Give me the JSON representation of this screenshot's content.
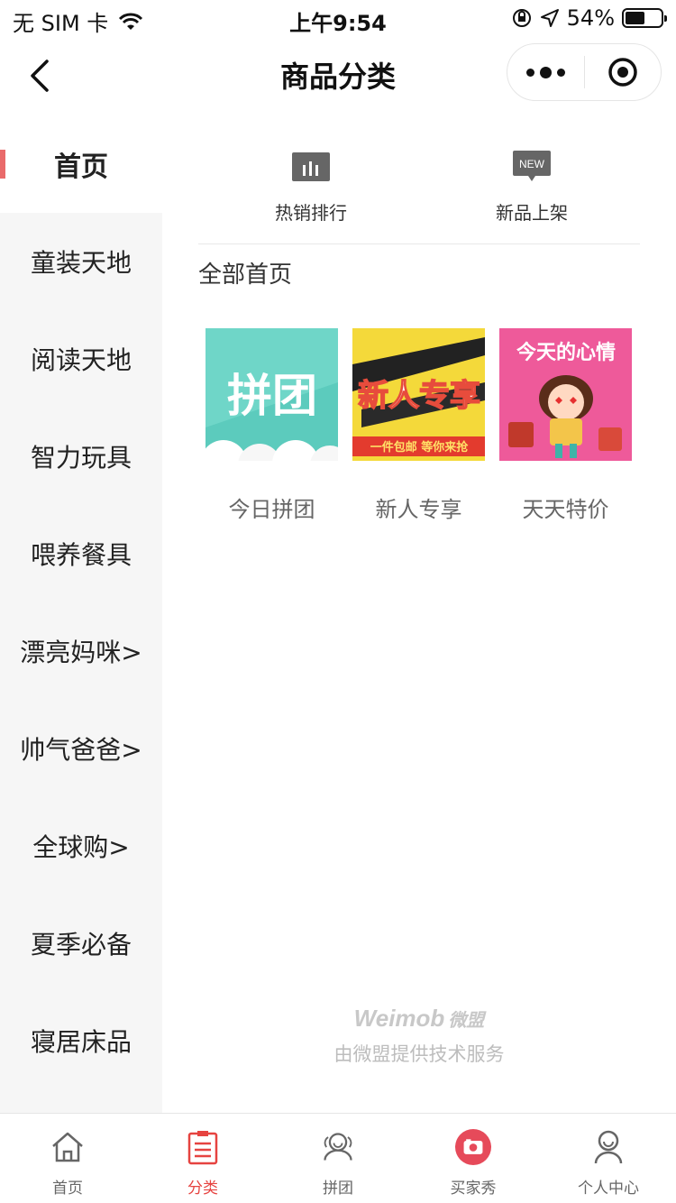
{
  "status": {
    "carrier": "无 SIM 卡",
    "time": "上午9:54",
    "battery_percent": "54%",
    "battery_level": 0.54
  },
  "nav": {
    "title": "商品分类"
  },
  "sidebar": {
    "items": [
      {
        "label": "首页",
        "active": true
      },
      {
        "label": "童装天地"
      },
      {
        "label": "阅读天地"
      },
      {
        "label": "智力玩具"
      },
      {
        "label": "喂养餐具"
      },
      {
        "label": "漂亮妈咪>"
      },
      {
        "label": "帅气爸爸>"
      },
      {
        "label": "全球购>"
      },
      {
        "label": "夏季必备"
      },
      {
        "label": "寝居床品"
      }
    ]
  },
  "content": {
    "quick_links": [
      {
        "label": "热销排行",
        "icon": "bar-chart-icon"
      },
      {
        "label": "新品上架",
        "icon": "new-badge-icon",
        "badge": "NEW"
      }
    ],
    "section_title": "全部首页",
    "cards": [
      {
        "caption": "今日拼团",
        "image_text": "拼团"
      },
      {
        "caption": "新人专享",
        "image_text": "新人专享",
        "image_subtext": "一件包邮 等你来抢"
      },
      {
        "caption": "天天特价",
        "image_text": "今天的心情"
      }
    ]
  },
  "footer": {
    "brand": "Weimob",
    "brand_cn": "微盟",
    "service_text": "由微盟提供技术服务"
  },
  "tabbar": {
    "items": [
      {
        "label": "首页",
        "icon": "home-icon"
      },
      {
        "label": "分类",
        "icon": "clipboard-list-icon",
        "active": true
      },
      {
        "label": "拼团",
        "icon": "group-icon"
      },
      {
        "label": "买家秀",
        "icon": "camera-icon"
      },
      {
        "label": "个人中心",
        "icon": "user-icon"
      }
    ]
  },
  "colors": {
    "accent": "#e64340",
    "sidebar_indicator": "#e96a6a",
    "sidebar_bg": "#f6f6f6"
  }
}
